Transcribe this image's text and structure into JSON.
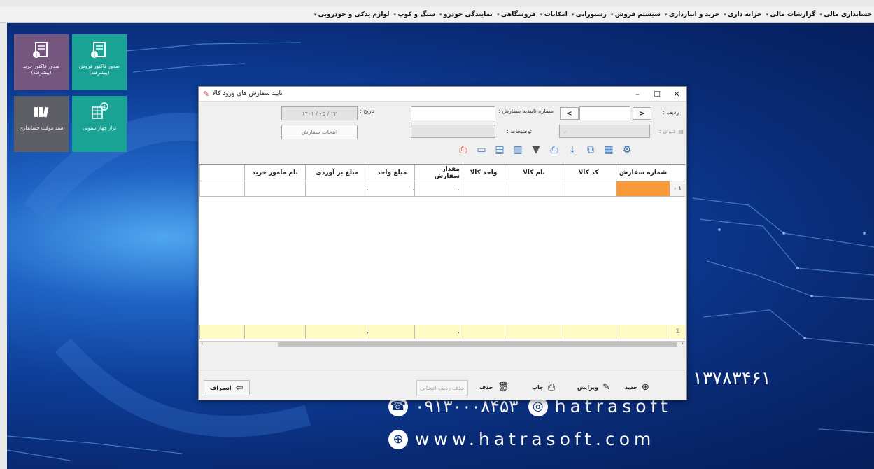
{
  "menu": [
    "حسابداری مالی",
    "گزارشات مالی",
    "خزانه داری",
    "خرید و انبارداری",
    "سیستم فروش",
    "رستورانی",
    "امکانات",
    "فروشگاهی",
    "نمایندگی خودرو",
    "سنگ و کوپ",
    "لوازم یدکی و خودرویی"
  ],
  "tiles": [
    {
      "label": "صدور فاکتور خرید (پیشرفته)",
      "color": "#74567f"
    },
    {
      "label": "صدور فاکتور فروش (پیشرفته)",
      "color": "#1aa394"
    },
    {
      "label": "سند موقت حسابداری",
      "color": "#5e5f66"
    },
    {
      "label": "تراز چهار ستونی",
      "color": "#1aa394"
    }
  ],
  "brand": {
    "phone1": "۱۳۷۸۳۴۶۱",
    "phone2": "۰۹۱۳۰۰۰۸۴۵۳",
    "instagram": "hatrasoft",
    "website": "www.hatrasoft.com"
  },
  "dialog": {
    "title": "تایید سفارش های ورود کالا",
    "row_label": "ردیف :",
    "nav_prev": "<",
    "nav_next": ">",
    "confirm_no_label": "شماره تاییدیه سفارش :",
    "date_label": "تاریخ :",
    "date_value": "۱۴۰۱ / ۰۵ / ۲۲",
    "title_label": "عنوان :",
    "description_label": "توضیحات :",
    "select_order": "انتخاب سفارش"
  },
  "grid": {
    "columns": [
      "",
      "شماره سفارش",
      "کد کالا",
      "نام کالا",
      "واحد کالا",
      "مقدار سفارش",
      "مبلغ واحد",
      "مبلغ بر آوردی",
      "نام مامور خرید",
      ""
    ],
    "rows": [
      {
        "row_no": "۱",
        "values": [
          "",
          "",
          "",
          "",
          ".",
          ".",
          ".",
          "",
          ""
        ]
      }
    ],
    "footer": {
      "sum_symbol": "Σ",
      "values": [
        "",
        "",
        "",
        "",
        ".",
        "",
        ".",
        "",
        ""
      ]
    }
  },
  "buttons": {
    "new": "جدید",
    "edit": "ویرایش",
    "print": "چاپ",
    "delete": "حذف",
    "delete_selected": "حذف ردیف انتخابی",
    "cancel": "انصراف"
  },
  "colors": {
    "selected_cell": "#f99a3a",
    "footer_row": "#fffbc4",
    "desktop": "#0d3d97"
  }
}
